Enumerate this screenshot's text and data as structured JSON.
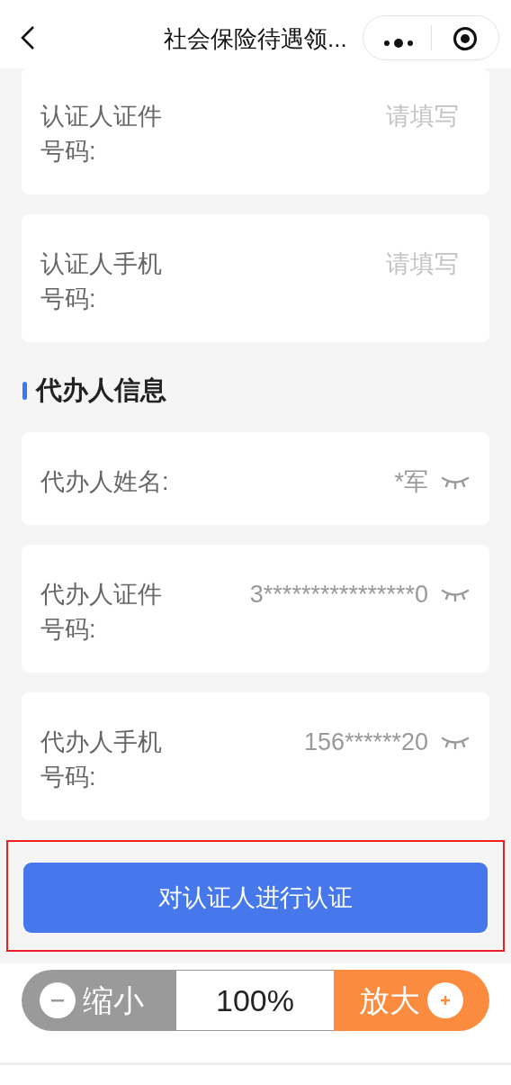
{
  "header": {
    "title": "社会保险待遇领..."
  },
  "groups": [
    {
      "fields": [
        {
          "kind": "input",
          "label": "认证人证件号码:",
          "placeholder": "请填写"
        },
        {
          "kind": "input",
          "label": "认证人手机号码:",
          "placeholder": "请填写"
        }
      ]
    },
    {
      "title": "代办人信息",
      "fields": [
        {
          "kind": "masked",
          "label": "代办人姓名:",
          "value": "*军"
        },
        {
          "kind": "masked",
          "label": "代办人证件号码:",
          "value": "3****************0"
        },
        {
          "kind": "masked",
          "label": "代办人手机号码:",
          "value": "156******20"
        }
      ]
    }
  ],
  "action": {
    "label": "对认证人进行认证",
    "highlighted": true
  },
  "zoom": {
    "shrink": "缩小",
    "percent": "100%",
    "enlarge": "放大"
  }
}
